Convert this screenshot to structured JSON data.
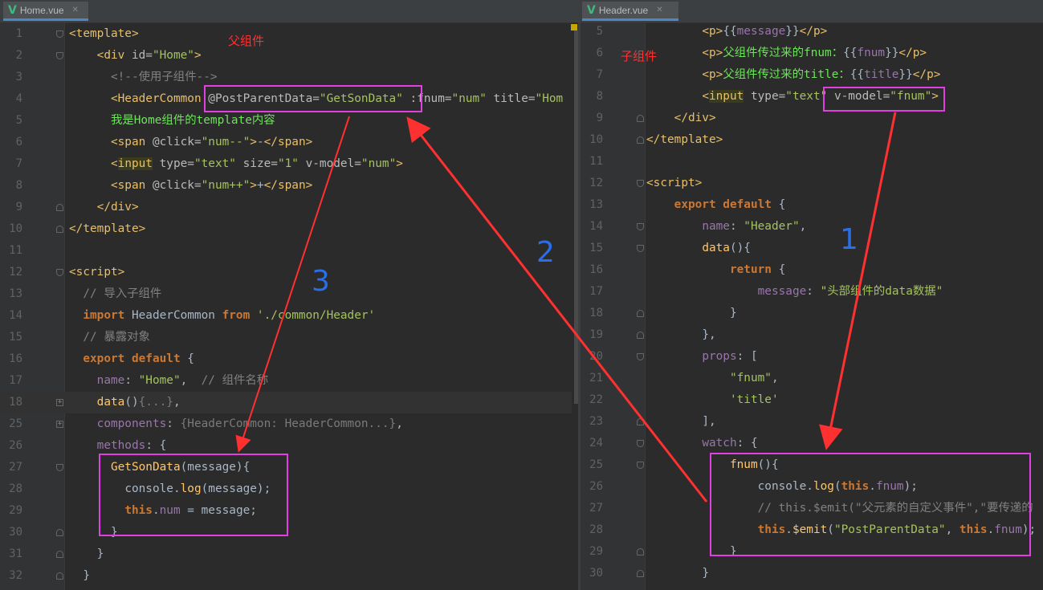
{
  "left_pane": {
    "tab": {
      "icon": "V",
      "name": "Home.vue",
      "close": "✕"
    },
    "annotation": "父组件",
    "lines": [
      {
        "num": "1",
        "code": [
          [
            "t-tag",
            "<template>"
          ]
        ]
      },
      {
        "num": "2",
        "code": [
          [
            "t-dim",
            "    "
          ],
          [
            "t-tag",
            "<div"
          ],
          [
            "t-attr",
            " id="
          ],
          [
            "t-str",
            "\"Home\""
          ],
          [
            "t-tag",
            ">"
          ]
        ]
      },
      {
        "num": "3",
        "code": [
          [
            "t-dim",
            "      "
          ],
          [
            "t-com",
            "<!--使用子组件-->"
          ]
        ]
      },
      {
        "num": "4",
        "code": [
          [
            "t-dim",
            "      "
          ],
          [
            "t-tag",
            "<HeaderCommon"
          ],
          [
            "t-attr",
            " @PostParentData="
          ],
          [
            "t-str",
            "\"GetSonData\""
          ],
          [
            "t-attr",
            " :fnum="
          ],
          [
            "t-str",
            "\"num\""
          ],
          [
            "t-attr",
            " title="
          ],
          [
            "t-str",
            "\"Hom"
          ]
        ]
      },
      {
        "num": "5",
        "code": [
          [
            "t-dim",
            "      "
          ],
          [
            "t-green",
            "我是Home组件的template内容"
          ]
        ]
      },
      {
        "num": "6",
        "code": [
          [
            "t-dim",
            "      "
          ],
          [
            "t-tag",
            "<span"
          ],
          [
            "t-attr",
            " @click="
          ],
          [
            "t-str",
            "\"num--\""
          ],
          [
            "t-tag",
            ">"
          ],
          [
            "t-txt",
            "-"
          ],
          [
            "t-tag",
            "</span>"
          ]
        ]
      },
      {
        "num": "7",
        "code": [
          [
            "t-dim",
            "      "
          ],
          [
            "t-tag",
            "<"
          ],
          [
            "t-tag t-input",
            "input"
          ],
          [
            "t-attr",
            " type="
          ],
          [
            "t-str",
            "\"text\""
          ],
          [
            "t-attr",
            " size="
          ],
          [
            "t-str",
            "\"1\""
          ],
          [
            "t-attr",
            " v-model="
          ],
          [
            "t-str",
            "\"num\""
          ],
          [
            "t-tag",
            ">"
          ]
        ]
      },
      {
        "num": "8",
        "code": [
          [
            "t-dim",
            "      "
          ],
          [
            "t-tag",
            "<span"
          ],
          [
            "t-attr",
            " @click="
          ],
          [
            "t-str",
            "\"num++\""
          ],
          [
            "t-tag",
            ">"
          ],
          [
            "t-txt",
            "+"
          ],
          [
            "t-tag",
            "</span>"
          ]
        ]
      },
      {
        "num": "9",
        "code": [
          [
            "t-dim",
            "    "
          ],
          [
            "t-tag",
            "</div>"
          ]
        ]
      },
      {
        "num": "10",
        "code": [
          [
            "t-tag",
            "</template>"
          ]
        ]
      },
      {
        "num": "11",
        "code": []
      },
      {
        "num": "12",
        "code": [
          [
            "t-tag",
            "<script>"
          ]
        ]
      },
      {
        "num": "13",
        "code": [
          [
            "t-dim",
            "  "
          ],
          [
            "t-com",
            "// 导入子组件"
          ]
        ]
      },
      {
        "num": "14",
        "code": [
          [
            "t-dim",
            "  "
          ],
          [
            "t-kw",
            "import"
          ],
          [
            "t-txt",
            " HeaderCommon "
          ],
          [
            "t-kw",
            "from"
          ],
          [
            "t-str",
            " './common/Header'"
          ]
        ]
      },
      {
        "num": "15",
        "code": [
          [
            "t-dim",
            "  "
          ],
          [
            "t-com",
            "// 暴露对象"
          ]
        ]
      },
      {
        "num": "16",
        "code": [
          [
            "t-dim",
            "  "
          ],
          [
            "t-kw",
            "export default"
          ],
          [
            "t-txt",
            " {"
          ]
        ]
      },
      {
        "num": "17",
        "code": [
          [
            "t-dim",
            "    "
          ],
          [
            "t-prop",
            "name"
          ],
          [
            "t-txt",
            ": "
          ],
          [
            "t-str",
            "\"Home\""
          ],
          [
            "t-txt",
            ",  "
          ],
          [
            "t-com",
            "// 组件名称"
          ]
        ]
      },
      {
        "num": "18",
        "code": [
          [
            "t-dim",
            "    "
          ],
          [
            "t-fn",
            "data"
          ],
          [
            "t-txt",
            "()"
          ],
          [
            "t-dim",
            "{...}"
          ],
          [
            "t-txt",
            ","
          ]
        ]
      },
      {
        "num": "25",
        "code": [
          [
            "t-dim",
            "    "
          ],
          [
            "t-prop",
            "components"
          ],
          [
            "t-txt",
            ": "
          ],
          [
            "t-dim",
            "{HeaderCommon: HeaderCommon...}"
          ],
          [
            "t-txt",
            ","
          ]
        ]
      },
      {
        "num": "26",
        "code": [
          [
            "t-dim",
            "    "
          ],
          [
            "t-prop",
            "methods"
          ],
          [
            "t-txt",
            ": {"
          ]
        ]
      },
      {
        "num": "27",
        "code": [
          [
            "t-dim",
            "      "
          ],
          [
            "t-fn",
            "GetSonData"
          ],
          [
            "t-txt",
            "(message){"
          ]
        ]
      },
      {
        "num": "28",
        "code": [
          [
            "t-dim",
            "        "
          ],
          [
            "t-txt",
            "console."
          ],
          [
            "t-fn",
            "log"
          ],
          [
            "t-txt",
            "(message);"
          ]
        ]
      },
      {
        "num": "29",
        "code": [
          [
            "t-dim",
            "        "
          ],
          [
            "t-kw",
            "this"
          ],
          [
            "t-txt",
            "."
          ],
          [
            "t-prop",
            "num"
          ],
          [
            "t-txt",
            " = message;"
          ]
        ]
      },
      {
        "num": "30",
        "code": [
          [
            "t-dim",
            "      "
          ],
          [
            "t-txt",
            "}"
          ]
        ]
      },
      {
        "num": "31",
        "code": [
          [
            "t-dim",
            "    "
          ],
          [
            "t-txt",
            "}"
          ]
        ]
      },
      {
        "num": "32",
        "code": [
          [
            "t-dim",
            "  "
          ],
          [
            "t-txt",
            "}"
          ]
        ]
      }
    ]
  },
  "right_pane": {
    "tab": {
      "icon": "V",
      "name": "Header.vue",
      "close": "✕"
    },
    "annotation": "子组件",
    "lines": [
      {
        "num": "5",
        "code": [
          [
            "t-dim",
            "        "
          ],
          [
            "t-tag",
            "<p>"
          ],
          [
            "t-txt",
            "{{"
          ],
          [
            "t-prop",
            "message"
          ],
          [
            "t-txt",
            "}}"
          ],
          [
            "t-tag",
            "</p>"
          ]
        ]
      },
      {
        "num": "6",
        "code": [
          [
            "t-dim",
            "        "
          ],
          [
            "t-tag",
            "<p>"
          ],
          [
            "t-green",
            "父组件传过来的fnum："
          ],
          [
            "t-txt",
            "{{"
          ],
          [
            "t-prop",
            "fnum"
          ],
          [
            "t-txt",
            "}}"
          ],
          [
            "t-tag",
            "</p>"
          ]
        ]
      },
      {
        "num": "7",
        "code": [
          [
            "t-dim",
            "        "
          ],
          [
            "t-tag",
            "<p>"
          ],
          [
            "t-green",
            "父组件传过来的title："
          ],
          [
            "t-txt",
            "{{"
          ],
          [
            "t-prop",
            "title"
          ],
          [
            "t-txt",
            "}}"
          ],
          [
            "t-tag",
            "</p>"
          ]
        ]
      },
      {
        "num": "8",
        "code": [
          [
            "t-dim",
            "        "
          ],
          [
            "t-tag",
            "<"
          ],
          [
            "t-tag t-input",
            "input"
          ],
          [
            "t-attr",
            " type="
          ],
          [
            "t-str",
            "\"text\""
          ],
          [
            "t-attr",
            " v-model="
          ],
          [
            "t-str",
            "\"fnum\""
          ],
          [
            "t-tag",
            ">"
          ]
        ]
      },
      {
        "num": "9",
        "code": [
          [
            "t-dim",
            "    "
          ],
          [
            "t-tag",
            "</div>"
          ]
        ]
      },
      {
        "num": "10",
        "code": [
          [
            "t-tag",
            "</template>"
          ]
        ]
      },
      {
        "num": "11",
        "code": []
      },
      {
        "num": "12",
        "code": [
          [
            "t-tag",
            "<script>"
          ]
        ]
      },
      {
        "num": "13",
        "code": [
          [
            "t-dim",
            "    "
          ],
          [
            "t-kw",
            "export default"
          ],
          [
            "t-txt",
            " {"
          ]
        ]
      },
      {
        "num": "14",
        "code": [
          [
            "t-dim",
            "        "
          ],
          [
            "t-prop",
            "name"
          ],
          [
            "t-txt",
            ": "
          ],
          [
            "t-str",
            "\"Header\""
          ],
          [
            "t-txt",
            ","
          ]
        ]
      },
      {
        "num": "15",
        "code": [
          [
            "t-dim",
            "        "
          ],
          [
            "t-fn",
            "data"
          ],
          [
            "t-txt",
            "(){"
          ]
        ]
      },
      {
        "num": "16",
        "code": [
          [
            "t-dim",
            "            "
          ],
          [
            "t-kw",
            "return"
          ],
          [
            "t-txt",
            " {"
          ]
        ]
      },
      {
        "num": "17",
        "code": [
          [
            "t-dim",
            "                "
          ],
          [
            "t-prop",
            "message"
          ],
          [
            "t-txt",
            ": "
          ],
          [
            "t-str",
            "\"头部组件的data数据\""
          ]
        ]
      },
      {
        "num": "18",
        "code": [
          [
            "t-dim",
            "            "
          ],
          [
            "t-txt",
            "}"
          ]
        ]
      },
      {
        "num": "19",
        "code": [
          [
            "t-dim",
            "        "
          ],
          [
            "t-txt",
            "},"
          ]
        ]
      },
      {
        "num": "20",
        "code": [
          [
            "t-dim",
            "        "
          ],
          [
            "t-prop",
            "props"
          ],
          [
            "t-txt",
            ": ["
          ]
        ]
      },
      {
        "num": "21",
        "code": [
          [
            "t-dim",
            "            "
          ],
          [
            "t-str",
            "\"fnum\""
          ],
          [
            "t-txt",
            ","
          ]
        ]
      },
      {
        "num": "22",
        "code": [
          [
            "t-dim",
            "            "
          ],
          [
            "t-str",
            "'title'"
          ]
        ]
      },
      {
        "num": "23",
        "code": [
          [
            "t-dim",
            "        "
          ],
          [
            "t-txt",
            "],"
          ]
        ]
      },
      {
        "num": "24",
        "code": [
          [
            "t-dim",
            "        "
          ],
          [
            "t-prop",
            "watch"
          ],
          [
            "t-txt",
            ": {"
          ]
        ]
      },
      {
        "num": "25",
        "code": [
          [
            "t-dim",
            "            "
          ],
          [
            "t-fn",
            "fnum"
          ],
          [
            "t-txt",
            "(){"
          ]
        ]
      },
      {
        "num": "26",
        "code": [
          [
            "t-dim",
            "                "
          ],
          [
            "t-txt",
            "console."
          ],
          [
            "t-fn",
            "log"
          ],
          [
            "t-txt",
            "("
          ],
          [
            "t-kw",
            "this"
          ],
          [
            "t-txt",
            "."
          ],
          [
            "t-prop",
            "fnum"
          ],
          [
            "t-txt",
            ");"
          ]
        ]
      },
      {
        "num": "27",
        "code": [
          [
            "t-dim",
            "                "
          ],
          [
            "t-com",
            "// this.$emit(\"父元素的自定义事件\",\"要传递的"
          ]
        ]
      },
      {
        "num": "28",
        "code": [
          [
            "t-dim",
            "                "
          ],
          [
            "t-kw",
            "this"
          ],
          [
            "t-txt",
            "."
          ],
          [
            "t-fn",
            "$emit"
          ],
          [
            "t-txt",
            "("
          ],
          [
            "t-str",
            "\"PostParentData\""
          ],
          [
            "t-txt",
            ", "
          ],
          [
            "t-kw",
            "this"
          ],
          [
            "t-txt",
            "."
          ],
          [
            "t-prop",
            "fnum"
          ],
          [
            "t-txt",
            ");"
          ]
        ]
      },
      {
        "num": "29",
        "code": [
          [
            "t-dim",
            "            "
          ],
          [
            "t-txt",
            "}"
          ]
        ]
      },
      {
        "num": "30",
        "code": [
          [
            "t-dim",
            "        "
          ],
          [
            "t-txt",
            "}"
          ]
        ]
      }
    ]
  },
  "handwritten": {
    "one": "1",
    "two": "2",
    "three": "3"
  },
  "colors": {
    "highlight_box": "#e040e0",
    "arrow": "#ff3030",
    "handwriting": "#2a6ee8"
  }
}
